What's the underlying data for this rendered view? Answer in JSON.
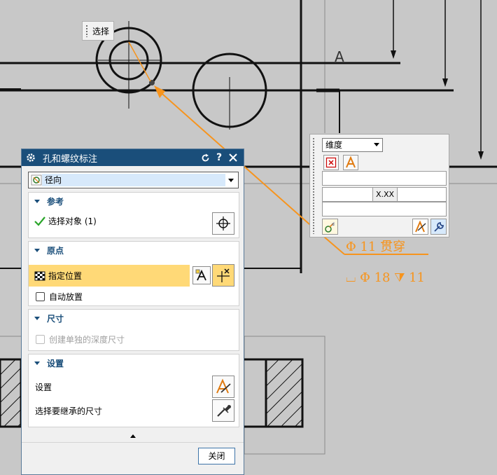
{
  "canvas": {
    "tooltip": "选择",
    "annotation_line1": "Φ 11 贯穿",
    "annotation_line2": "⌴ Φ 18 ⧩ 11",
    "label_a": "A"
  },
  "dimension_toolbar": {
    "style_dropdown": "维度",
    "precision_label": "X.XX"
  },
  "dialog": {
    "title": "孔和螺纹标注",
    "type_dropdown": "径向",
    "reference": {
      "header": "参考",
      "select_object": "选择对象 (1)"
    },
    "origin": {
      "header": "原点",
      "specify_location": "指定位置",
      "auto_place": "自动放置"
    },
    "dimension": {
      "header": "尺寸",
      "create_depth": "创建单独的深度尺寸"
    },
    "settings": {
      "header": "设置",
      "settings_label": "设置",
      "inherit_label": "选择要继承的尺寸"
    },
    "close_button": "关闭"
  },
  "colors": {
    "title_bar": "#1a4e7a",
    "highlight": "#ffd977",
    "annotation": "#f7941d",
    "canvas_bg": "#c8c8c8"
  }
}
